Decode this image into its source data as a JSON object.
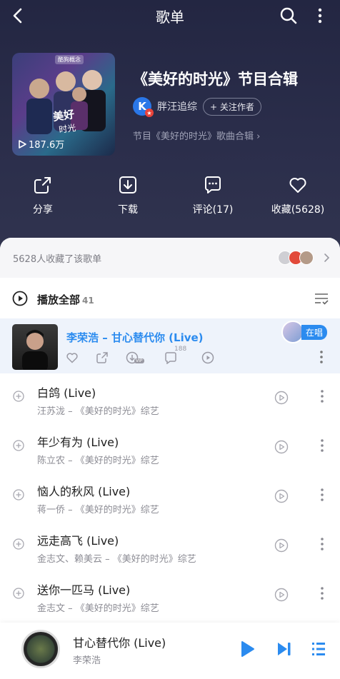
{
  "nav": {
    "title": "歌单"
  },
  "playlist": {
    "cover_tag": "酷狗概念",
    "play_count": "187.6万",
    "title": "《美好的时光》节目合辑",
    "author_name": "胖汪追综",
    "author_avatar_letter": "K",
    "follow_label": "+ 关注作者",
    "description": "节目《美好的时光》歌曲合辑"
  },
  "actions": [
    {
      "label": "分享",
      "icon": "share-icon"
    },
    {
      "label": "下载",
      "icon": "download-icon"
    },
    {
      "label": "评论(17)",
      "icon": "comment-icon"
    },
    {
      "label": "收藏(5628)",
      "icon": "heart-icon"
    }
  ],
  "collected": {
    "text": "5628人收藏了该歌单"
  },
  "play_all": {
    "label": "播放全部",
    "count": "41"
  },
  "now_playing": {
    "song": "李荣浩 – 甘心替代你 (Live)",
    "comment_count": "188",
    "vip": "VIP",
    "status_chip": "在唱"
  },
  "songs": [
    {
      "title": "白鸽 (Live)",
      "subtitle": "汪苏泷 – 《美好的时光》综艺"
    },
    {
      "title": "年少有为 (Live)",
      "subtitle": "陈立农 – 《美好的时光》综艺"
    },
    {
      "title": "恼人的秋风 (Live)",
      "subtitle": "蒋一侨 – 《美好的时光》综艺"
    },
    {
      "title": "远走高飞 (Live)",
      "subtitle": "金志文、赖美云 – 《美好的时光》综艺"
    },
    {
      "title": "送你一匹马 (Live)",
      "subtitle": "金志文 – 《美好的时光》综艺"
    }
  ],
  "player": {
    "title": "甘心替代你 (Live)",
    "artist": "李荣浩"
  },
  "colors": {
    "accent": "#2b8bef",
    "header_bg": "#2b2e4b"
  }
}
